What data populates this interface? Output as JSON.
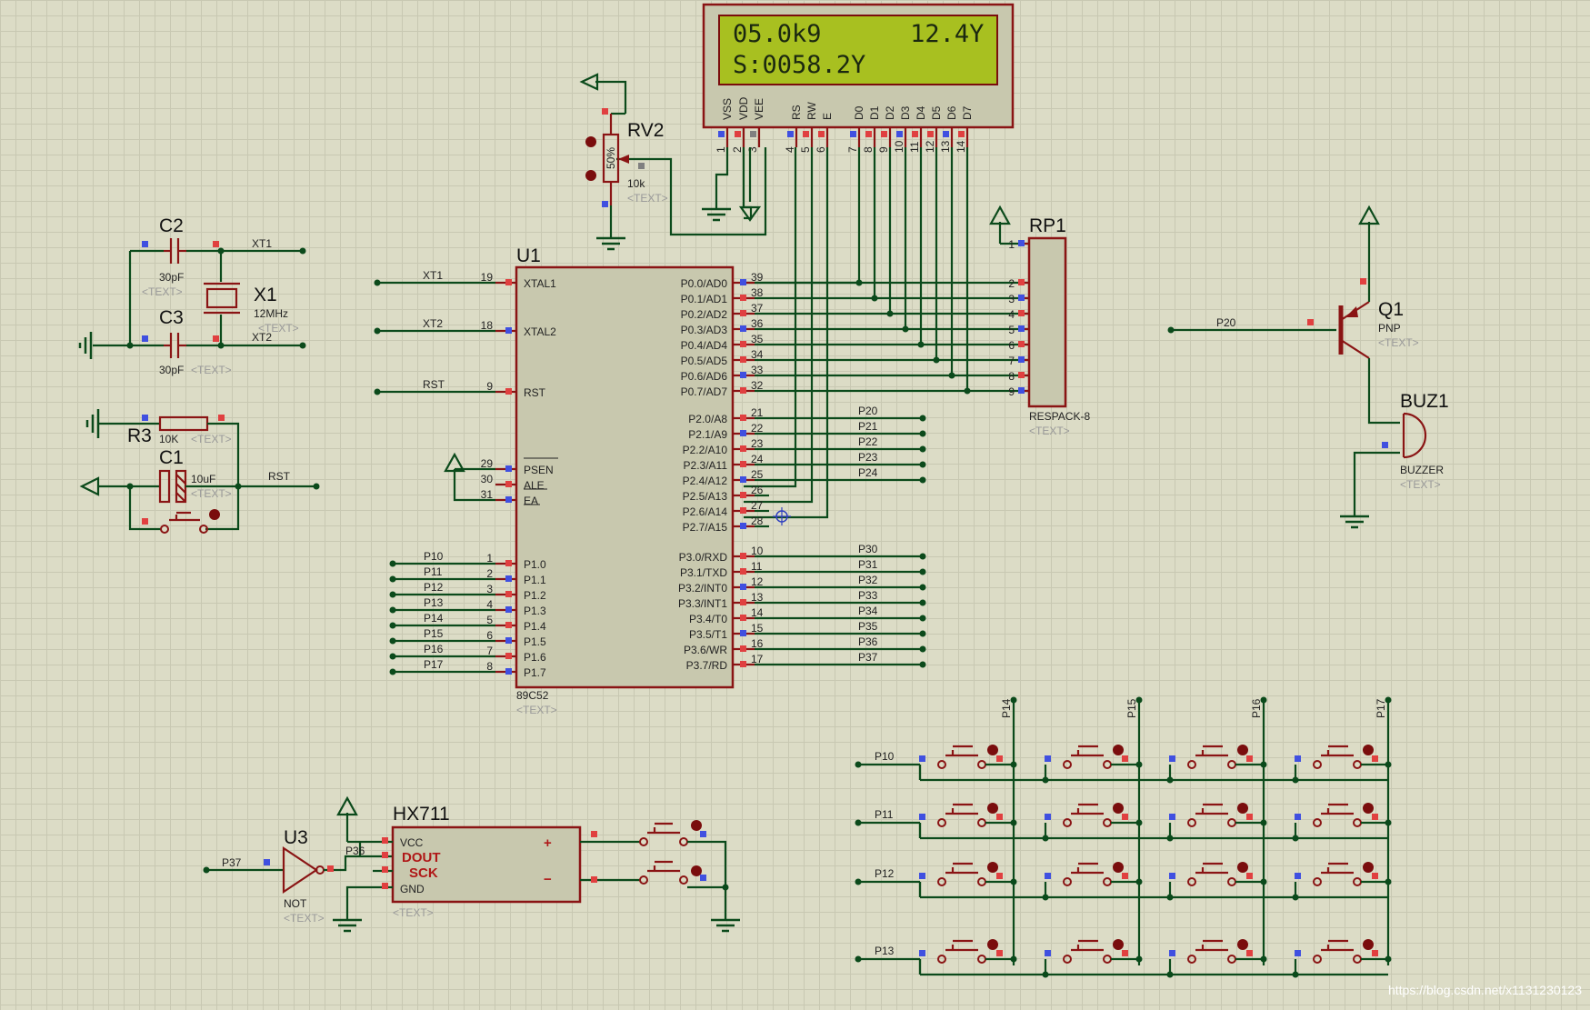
{
  "lcd": {
    "line1": "05.0k9      12.4Y",
    "line2": "S:0058.2Y",
    "pins": [
      "VSS",
      "VDD",
      "VEE",
      "RS",
      "RW",
      "E",
      "D0",
      "D1",
      "D2",
      "D3",
      "D4",
      "D5",
      "D6",
      "D7"
    ],
    "numbers": [
      "1",
      "2",
      "3",
      "4",
      "5",
      "6",
      "7",
      "8",
      "9",
      "10",
      "11",
      "12",
      "13",
      "14"
    ]
  },
  "rv2": {
    "ref": "RV2",
    "value": "10k",
    "percent": "50%",
    "text": "<TEXT>"
  },
  "c2": {
    "ref": "C2",
    "value": "30pF",
    "text": "<TEXT>"
  },
  "c3": {
    "ref": "C3",
    "value": "30pF",
    "text": "<TEXT>"
  },
  "x1": {
    "ref": "X1",
    "value": "12MHz",
    "text": "<TEXT>"
  },
  "r3": {
    "ref": "R3",
    "value": "10K",
    "text": "<TEXT>"
  },
  "c1": {
    "ref": "C1",
    "value": "10uF",
    "text": "<TEXT>"
  },
  "nets": {
    "xt1": "XT1",
    "xt2": "XT2",
    "rst": "RST",
    "p20": "P20",
    "p37": "P37",
    "p36": "P36"
  },
  "u1": {
    "ref": "U1",
    "part": "89C52",
    "text": "<TEXT>",
    "left": [
      {
        "num": "19",
        "name": "XTAL1",
        "net": "XT1"
      },
      {
        "num": "18",
        "name": "XTAL2",
        "net": "XT2"
      },
      {
        "num": "9",
        "name": "RST",
        "net": "RST"
      },
      {
        "num": "29",
        "name": "PSEN",
        "net": ""
      },
      {
        "num": "30",
        "name": "ALE",
        "net": ""
      },
      {
        "num": "31",
        "name": "EA",
        "net": ""
      },
      {
        "num": "1",
        "name": "P1.0",
        "net": "P10"
      },
      {
        "num": "2",
        "name": "P1.1",
        "net": "P11"
      },
      {
        "num": "3",
        "name": "P1.2",
        "net": "P12"
      },
      {
        "num": "4",
        "name": "P1.3",
        "net": "P13"
      },
      {
        "num": "5",
        "name": "P1.4",
        "net": "P14"
      },
      {
        "num": "6",
        "name": "P1.5",
        "net": "P15"
      },
      {
        "num": "7",
        "name": "P1.6",
        "net": "P16"
      },
      {
        "num": "8",
        "name": "P1.7",
        "net": "P17"
      }
    ],
    "right": [
      {
        "num": "39",
        "name": "P0.0/AD0",
        "net": ""
      },
      {
        "num": "38",
        "name": "P0.1/AD1",
        "net": ""
      },
      {
        "num": "37",
        "name": "P0.2/AD2",
        "net": ""
      },
      {
        "num": "36",
        "name": "P0.3/AD3",
        "net": ""
      },
      {
        "num": "35",
        "name": "P0.4/AD4",
        "net": ""
      },
      {
        "num": "34",
        "name": "P0.5/AD5",
        "net": ""
      },
      {
        "num": "33",
        "name": "P0.6/AD6",
        "net": ""
      },
      {
        "num": "32",
        "name": "P0.7/AD7",
        "net": ""
      },
      {
        "num": "21",
        "name": "P2.0/A8",
        "net": "P20"
      },
      {
        "num": "22",
        "name": "P2.1/A9",
        "net": "P21"
      },
      {
        "num": "23",
        "name": "P2.2/A10",
        "net": "P22"
      },
      {
        "num": "24",
        "name": "P2.3/A11",
        "net": "P23"
      },
      {
        "num": "25",
        "name": "P2.4/A12",
        "net": "P24"
      },
      {
        "num": "26",
        "name": "P2.5/A13",
        "net": ""
      },
      {
        "num": "27",
        "name": "P2.6/A14",
        "net": ""
      },
      {
        "num": "28",
        "name": "P2.7/A15",
        "net": ""
      },
      {
        "num": "10",
        "name": "P3.0/RXD",
        "net": "P30"
      },
      {
        "num": "11",
        "name": "P3.1/TXD",
        "net": "P31"
      },
      {
        "num": "12",
        "name": "P3.2/INT0",
        "net": "P32"
      },
      {
        "num": "13",
        "name": "P3.3/INT1",
        "net": "P33"
      },
      {
        "num": "14",
        "name": "P3.4/T0",
        "net": "P34"
      },
      {
        "num": "15",
        "name": "P3.5/T1",
        "net": "P35"
      },
      {
        "num": "16",
        "name": "P3.6/WR",
        "net": "P36"
      },
      {
        "num": "17",
        "name": "P3.7/RD",
        "net": "P37"
      }
    ]
  },
  "rp1": {
    "ref": "RP1",
    "part": "RESPACK-8",
    "text": "<TEXT>",
    "pins": [
      "1",
      "2",
      "3",
      "4",
      "5",
      "6",
      "7",
      "8",
      "9"
    ]
  },
  "q1": {
    "ref": "Q1",
    "type": "PNP",
    "text": "<TEXT>"
  },
  "buz1": {
    "ref": "BUZ1",
    "part": "BUZZER",
    "text": "<TEXT>"
  },
  "u3": {
    "ref": "U3",
    "part": "NOT",
    "text": "<TEXT>"
  },
  "hx711": {
    "ref": "HX711",
    "vcc": "VCC",
    "dout": "DOUT",
    "sck": "SCK",
    "gnd": "GND",
    "plus": "+",
    "minus": "−",
    "text": "<TEXT>"
  },
  "keypad": {
    "rows": [
      "P10",
      "P11",
      "P12",
      "P13"
    ],
    "cols": [
      "P14",
      "P15",
      "P16",
      "P17"
    ]
  },
  "watermark": "https://blog.csdn.net/x1131230123"
}
